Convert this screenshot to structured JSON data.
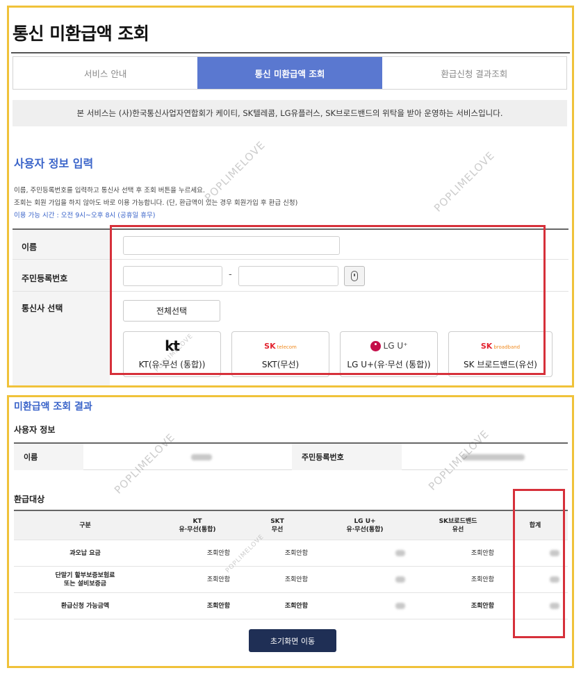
{
  "page_title": "통신 미환급액 조회",
  "tabs": [
    {
      "label": "서비스 안내",
      "active": false
    },
    {
      "label": "통신 미환급액 조회",
      "active": true
    },
    {
      "label": "환급신청 결과조회",
      "active": false
    }
  ],
  "notice": "본 서비스는 (사)한국통신사업자연합회가 케이티, SK텔레콤, LG유플러스, SK브로드밴드의 위탁을 받아 운영하는 서비스입니다.",
  "user_input": {
    "section_title": "사용자 정보 입력",
    "desc_line1": "이름, 주민등록번호를 입력하고 통신사 선택 후 조회 버튼을 누르세요.",
    "desc_line2": "조회는 회원 가입을 하지 않아도 바로 이용 가능합니다. (단, 환급액이 있는 경우 회원가입 후 환급 신청)",
    "desc_line3": "이용 가능 시간 : 오전 9시~오후 8시 (공휴일 휴무)",
    "name_label": "이름",
    "name_value": "",
    "rrn_label": "주민등록번호",
    "rrn_front": "",
    "rrn_back": "",
    "rrn_separator": "-",
    "carrier_label": "통신사 선택",
    "select_all_label": "전체선택",
    "carriers": [
      {
        "logo_text": "kt",
        "label": "KT(유·무선 (통합))",
        "logo_icon": "kt-logo"
      },
      {
        "logo_text": "SK",
        "logo_sub": "telecom",
        "label": "SKT(무선)",
        "logo_icon": "sk-telecom-logo"
      },
      {
        "logo_text": "LG U⁺",
        "label": "LG U+(유·무선 (통합))",
        "logo_icon": "lg-uplus-logo"
      },
      {
        "logo_text": "SK",
        "logo_sub": "broadband",
        "label": "SK 브로드밴드(유선)",
        "logo_icon": "sk-broadband-logo"
      }
    ]
  },
  "result": {
    "title": "미환급액 조회 결과",
    "user_info_title": "사용자 정보",
    "name_label": "이름",
    "rrn_label": "주민등록번호",
    "refund_target_title": "환급대상",
    "columns": [
      {
        "line1": "구분",
        "line2": ""
      },
      {
        "line1": "KT",
        "line2": "유·무선(통합)"
      },
      {
        "line1": "SKT",
        "line2": "무선"
      },
      {
        "line1": "LG U+",
        "line2": "유·무선(통합)"
      },
      {
        "line1": "SK브로드밴드",
        "line2": "유선"
      },
      {
        "line1": "합계",
        "line2": ""
      }
    ],
    "rows": [
      {
        "line1": "과오납 요금",
        "line2": "",
        "kt": "조회안함",
        "skt": "조회안함",
        "sk_bb": "조회안함"
      },
      {
        "line1": "단말기 할부보증보험료",
        "line2": "또는 설비보증금",
        "kt": "조회안함",
        "skt": "조회안함",
        "sk_bb": "조회안함"
      },
      {
        "line1": "환급신청 가능금액",
        "line2": "",
        "kt": "조회안함",
        "skt": "조회안함",
        "sk_bb": "조회안함"
      }
    ],
    "reset_button": "초기화면 이동"
  },
  "watermark": "POPLIMELOVE",
  "colors": {
    "highlight_border": "#f0c23a",
    "annotation_red": "#d6303a",
    "accent_blue": "#3a64c9",
    "active_tab": "#5a78d0",
    "reset_button": "#1f2f55"
  }
}
